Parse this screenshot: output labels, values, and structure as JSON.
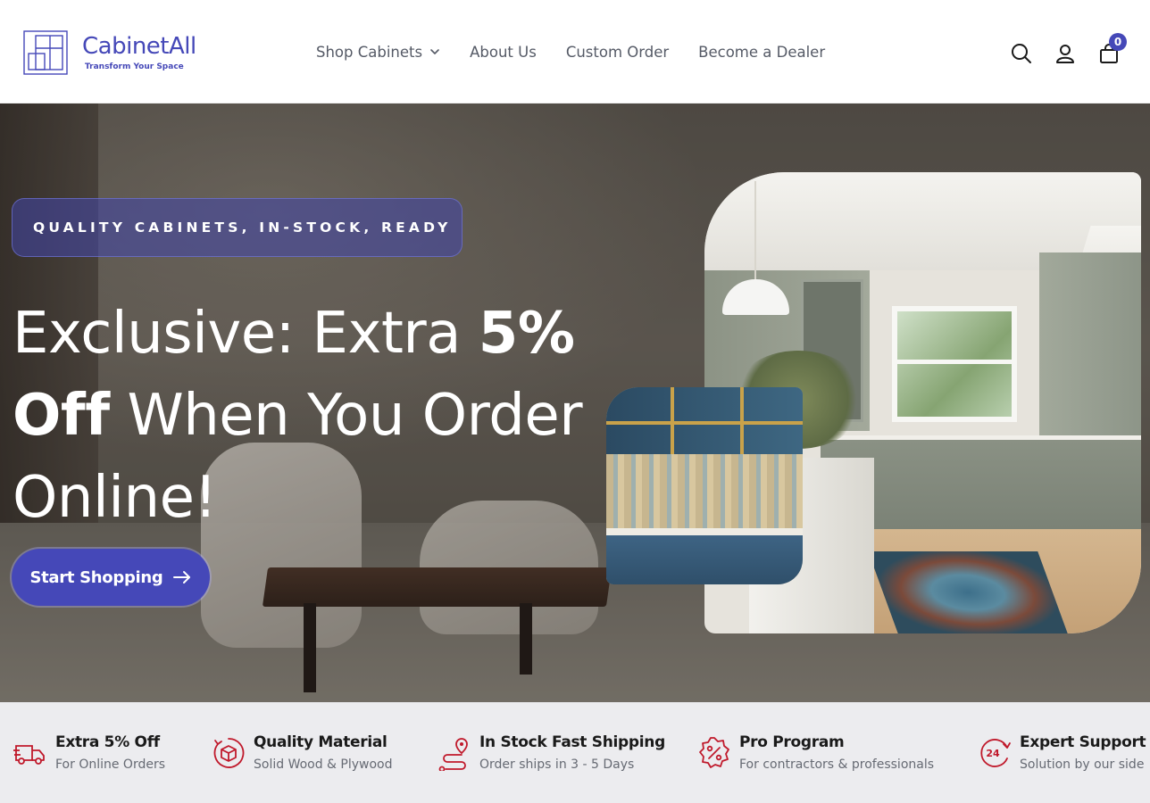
{
  "brand": {
    "name": "CabinetAll",
    "tagline": "Transform Your Space",
    "color": "#4548b8"
  },
  "nav": {
    "items": [
      {
        "label": "Shop Cabinets",
        "has_dropdown": true
      },
      {
        "label": "About Us"
      },
      {
        "label": "Custom Order"
      },
      {
        "label": "Become a Dealer"
      }
    ]
  },
  "header_icons": {
    "search": "search-icon",
    "account": "user-icon",
    "cart": "shopping-bag-icon",
    "cart_count": "0"
  },
  "hero": {
    "badge": "QUALITY CABINETS, IN-STOCK, READY",
    "headline_part1": "Exclusive: Extra ",
    "headline_bold1": "5%",
    "headline_bold2": "Off",
    "headline_part2": " When You Order Online!",
    "cta_label": "Start Shopping",
    "cta_icon": "arrow-right-icon"
  },
  "features": [
    {
      "icon": "delivery-truck-icon",
      "title": "Extra 5% Off",
      "subtitle": "For Online Orders"
    },
    {
      "icon": "box-icon",
      "title": "Quality Material",
      "subtitle": "Solid Wood & Plywood"
    },
    {
      "icon": "route-icon",
      "title": "In Stock Fast Shipping",
      "subtitle": "Order ships in 3 - 5 Days"
    },
    {
      "icon": "discount-badge-icon",
      "title": "Pro Program",
      "subtitle": "For contractors & professionals"
    },
    {
      "icon": "support-24-icon",
      "title": "Expert Support",
      "subtitle": "Solution by our side"
    }
  ],
  "colors": {
    "accent": "#4548b8",
    "feature_icon": "#c0192b",
    "features_bg": "#ececef"
  }
}
